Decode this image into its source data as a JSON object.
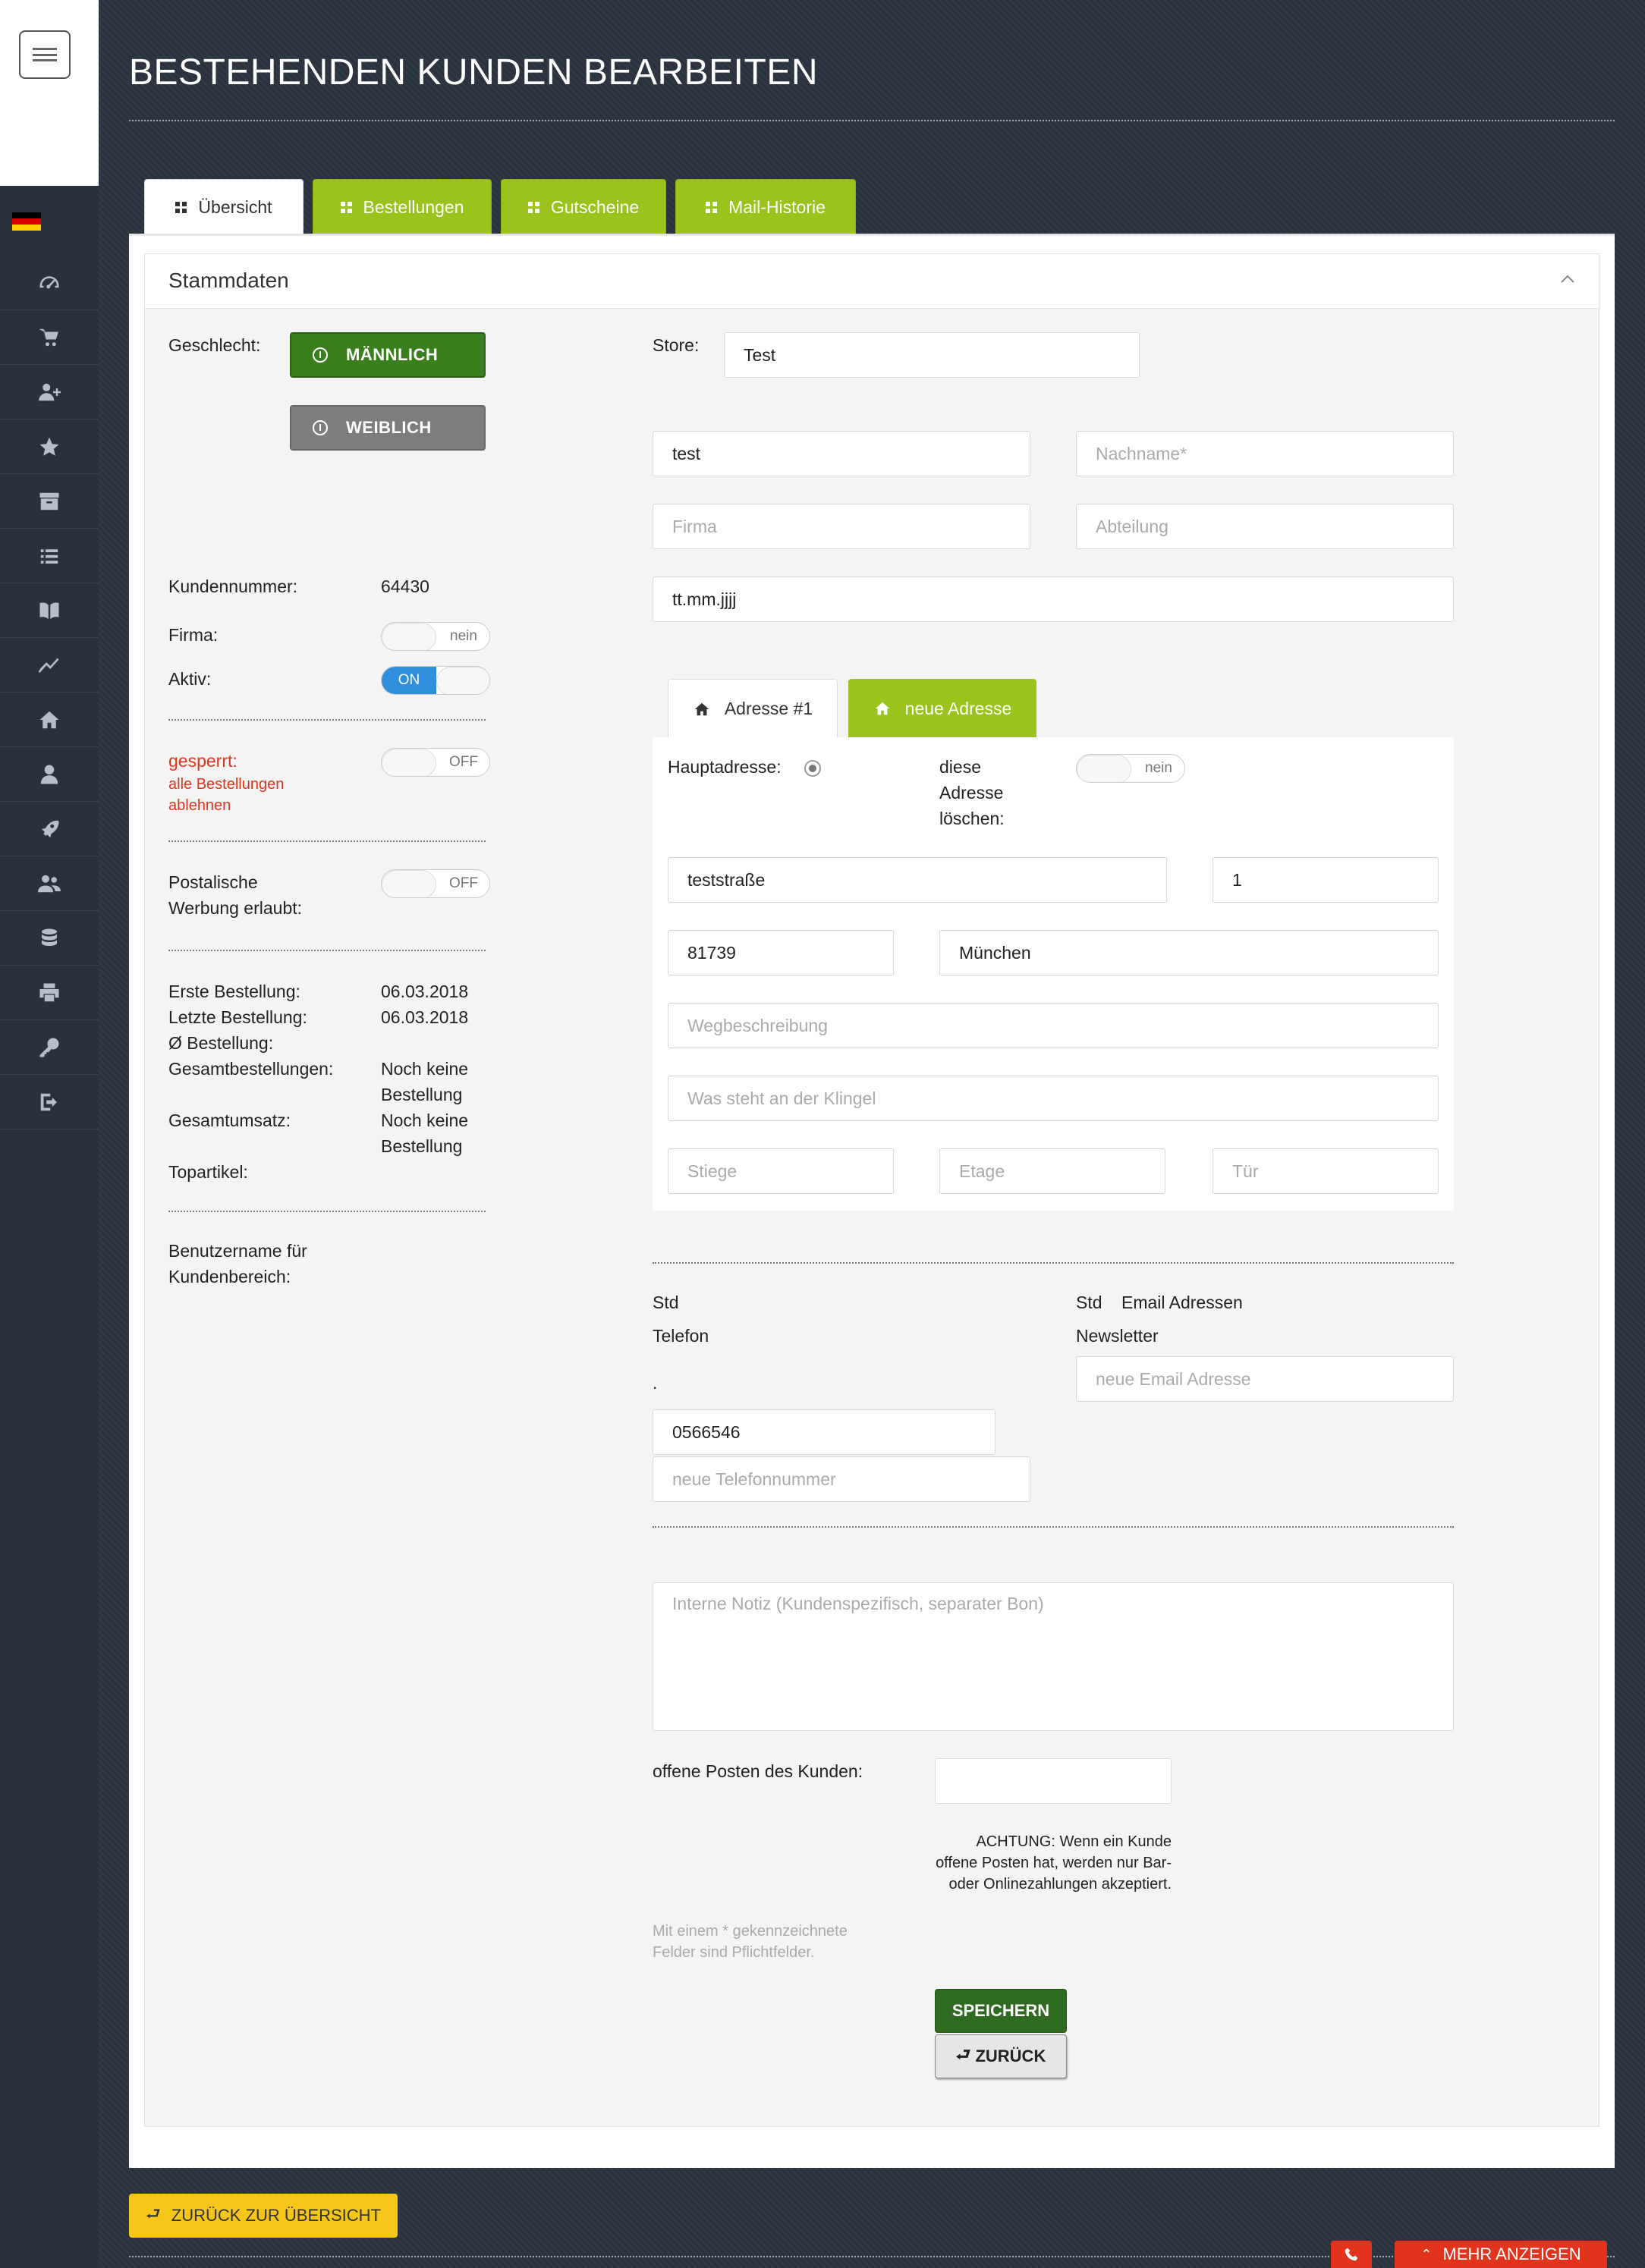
{
  "page": {
    "title": "BESTEHENDEN KUNDEN BEARBEITEN"
  },
  "sidebar": {
    "language_flag": "de-flag",
    "items": [
      {
        "icon": "dashboard-icon"
      },
      {
        "icon": "cart-icon"
      },
      {
        "icon": "add-user-icon"
      },
      {
        "icon": "star-icon"
      },
      {
        "icon": "archive-icon"
      },
      {
        "icon": "list-icon"
      },
      {
        "icon": "book-icon"
      },
      {
        "icon": "chart-icon"
      },
      {
        "icon": "home-icon"
      },
      {
        "icon": "user-icon"
      },
      {
        "icon": "rocket-icon"
      },
      {
        "icon": "users-icon"
      },
      {
        "icon": "database-icon"
      },
      {
        "icon": "print-icon"
      },
      {
        "icon": "key-icon"
      },
      {
        "icon": "logout-icon"
      }
    ]
  },
  "tabs": [
    {
      "label": "Übersicht",
      "active": true
    },
    {
      "label": "Bestellungen",
      "active": false
    },
    {
      "label": "Gutscheine",
      "active": false
    },
    {
      "label": "Mail-Historie",
      "active": false
    }
  ],
  "panel": {
    "title": "Stammdaten"
  },
  "left": {
    "gender_label": "Geschlecht:",
    "male_label": "MÄNNLICH",
    "female_label": "WEIBLICH",
    "customer_no_label": "Kundennummer:",
    "customer_no": "64430",
    "company_label": "Firma:",
    "company_toggle": "nein",
    "active_label": "Aktiv:",
    "active_toggle": "ON",
    "blocked_label": "gesperrt:",
    "blocked_note_1": "alle Bestellungen",
    "blocked_note_2": "ablehnen",
    "blocked_toggle": "OFF",
    "postal_label_1": "Postalische",
    "postal_label_2": "Werbung erlaubt:",
    "postal_toggle": "OFF",
    "first_order_label": "Erste Bestellung:",
    "first_order": "06.03.2018",
    "last_order_label": "Letzte Bestellung:",
    "last_order": "06.03.2018",
    "avg_order_label": "Ø Bestellung:",
    "total_orders_label": "Gesamtbestellungen:",
    "total_orders_1": "Noch keine",
    "total_orders_2": "Bestellung",
    "total_revenue_label": "Gesamtumsatz:",
    "total_revenue_1": "Noch keine",
    "total_revenue_2": "Bestellung",
    "top_article_label": "Topartikel:",
    "username_label_1": "Benutzername für",
    "username_label_2": "Kundenbereich:"
  },
  "right": {
    "store_label": "Store:",
    "store_value": "Test",
    "firstname_value": "test",
    "lastname_placeholder": "Nachname*",
    "company_placeholder": "Firma",
    "department_placeholder": "Abteilung",
    "birthday_placeholder": "tt.mm.jjjj",
    "addr_tab_1": "Adresse #1",
    "addr_tab_new": "neue Adresse",
    "main_addr_label": "Hauptadresse:",
    "delete_addr_1": "diese",
    "delete_addr_2": "Adresse",
    "delete_addr_3": "löschen:",
    "delete_toggle": "nein",
    "street": "teststraße",
    "house_no": "1",
    "zip": "81739",
    "city": "München",
    "directions_placeholder": "Wegbeschreibung",
    "doorbell_placeholder": "Was steht an der Klingel",
    "stair_placeholder": "Stiege",
    "floor_placeholder": "Etage",
    "door_placeholder": "Tür",
    "phone_std": "Std",
    "phone_label": "Telefon",
    "phone_dot": ".",
    "phone_value": "0566546",
    "phone_new_placeholder": "neue Telefonnummer",
    "email_std": "Std",
    "email_label": "Email Adressen",
    "newsletter_label": "Newsletter",
    "email_new_placeholder": "neue Email Adresse",
    "notes_placeholder": "Interne Notiz (Kundenspezifisch, separater Bon)",
    "open_items_label": "offene Posten des Kunden:",
    "open_items_value": "",
    "warning_1": "ACHTUNG: Wenn ein Kunde",
    "warning_2": "offene Posten hat, werden nur Bar-",
    "warning_3": "oder Onlinezahlungen akzeptiert.",
    "required_1": "Mit einem * gekennzeichnete",
    "required_2": "Felder sind Pflichtfelder.",
    "save_label": "SPEICHERN",
    "back_label": "ZURÜCK"
  },
  "footer": {
    "overview_label": "ZURÜCK ZUR ÜBERSICHT",
    "more_label": "MEHR ANZEIGEN"
  },
  "colors": {
    "accent_green": "#9ac31c",
    "male_green": "#3a7f1d",
    "female_gray": "#7d7d7d",
    "toggle_blue": "#2f8fdc",
    "alert_red": "#e2341c",
    "yellow": "#f5c518"
  }
}
